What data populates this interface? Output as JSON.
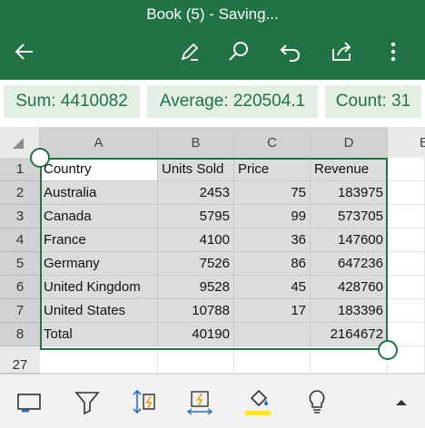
{
  "app": {
    "title": "Book (5) - Saving...",
    "accent": "#217346"
  },
  "header_icons": [
    "back-arrow-icon",
    "draw-pen-icon",
    "search-icon",
    "undo-icon",
    "share-icon",
    "more-options-icon"
  ],
  "stats": {
    "sum": "Sum: 4410082",
    "average": "Average: 220504.1",
    "count": "Count: 31"
  },
  "sheet": {
    "columns": [
      "A",
      "B",
      "C",
      "D",
      "E"
    ],
    "rows": [
      {
        "num": "1",
        "cells": [
          "Country",
          "Units Sold",
          "Price",
          "Revenue"
        ]
      },
      {
        "num": "2",
        "cells": [
          "Australia",
          "2453",
          "75",
          "183975"
        ]
      },
      {
        "num": "3",
        "cells": [
          "Canada",
          "5795",
          "99",
          "573705"
        ]
      },
      {
        "num": "4",
        "cells": [
          "France",
          "4100",
          "36",
          "147600"
        ]
      },
      {
        "num": "5",
        "cells": [
          "Germany",
          "7526",
          "86",
          "647236"
        ]
      },
      {
        "num": "6",
        "cells": [
          "United Kingdom",
          "9528",
          "45",
          "428760"
        ]
      },
      {
        "num": "7",
        "cells": [
          "United States",
          "10788",
          "17",
          "183396"
        ]
      },
      {
        "num": "8",
        "cells": [
          "Total",
          "40190",
          "",
          "2164672"
        ]
      }
    ],
    "partial_row_num": "27"
  },
  "toolbar_icons": [
    "format-cells-icon",
    "filter-icon",
    "sort-icon",
    "flash-fill-icon",
    "fill-color-icon",
    "ideas-lightbulb-icon",
    "expand-ribbon-icon"
  ],
  "colors": {
    "highlight_yellow": "#ffeb00",
    "toolbar_blue": "#2a6fb6"
  }
}
